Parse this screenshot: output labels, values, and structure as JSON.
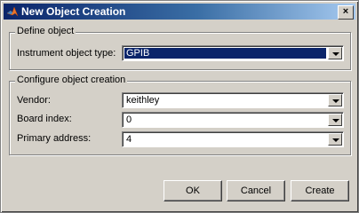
{
  "window": {
    "title": "New Object Creation",
    "close_glyph": "×"
  },
  "define": {
    "legend": "Define object",
    "type_label": "Instrument object type:",
    "type_value": "GPIB"
  },
  "configure": {
    "legend": "Configure object creation",
    "vendor_label": "Vendor:",
    "vendor_value": "keithley",
    "board_label": "Board index:",
    "board_value": "0",
    "primary_label": "Primary address:",
    "primary_value": "4"
  },
  "buttons": {
    "ok": "OK",
    "cancel": "Cancel",
    "create": "Create"
  },
  "colors": {
    "title_start": "#0a246a",
    "title_end": "#a6caf0",
    "selection": "#0a246a",
    "face": "#d4d0c8"
  },
  "icons": {
    "app": "matlab-logo-icon",
    "close": "close-icon",
    "dropdown": "chevron-down-icon"
  }
}
